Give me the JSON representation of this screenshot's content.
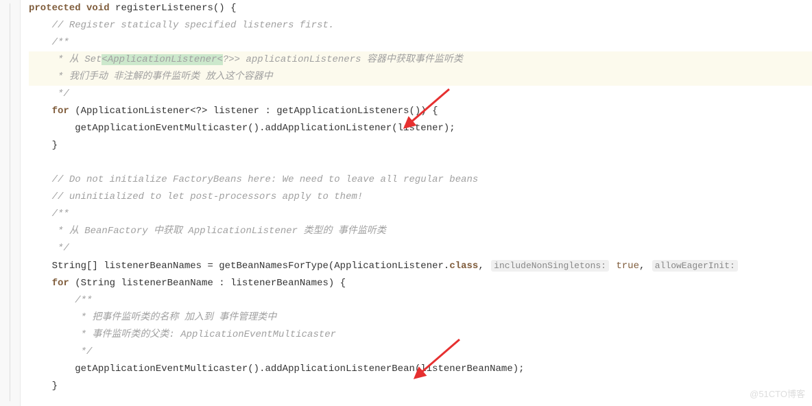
{
  "code": {
    "l1_protected": "protected",
    "l1_void": "void",
    "l1_name": "registerListeners",
    "l1_rest": "() {",
    "l2": "// Register statically specified listeners first.",
    "l3": "/**",
    "l4_pre": " * 从 Set",
    "l4_hl": "<ApplicationListener<",
    "l4_post": "?>> applicationListeners 容器中获取事件监听类",
    "l5": " * 我们手动 非注解的事件监听类 放入这个容器中",
    "l6": " */",
    "l7_for": "for",
    "l7_rest": " (ApplicationListener<?> listener : getApplicationListeners()) {",
    "l8": "getApplicationEventMulticaster().addApplicationListener(listener);",
    "l9": "}",
    "l11": "// Do not initialize FactoryBeans here: We need to leave all regular beans",
    "l12": "// uninitialized to let post-processors apply to them!",
    "l13": "/**",
    "l14": " * 从 BeanFactory 中获取 ApplicationListener 类型的 事件监听类",
    "l15": " */",
    "l16_a": "String[] listenerBeanNames = getBeanNamesForType(ApplicationListener.",
    "l16_class": "class",
    "l16_b": ", ",
    "l16_hint1": "includeNonSingletons:",
    "l16_true": " true",
    "l16_c": ", ",
    "l16_hint2": "allowEagerInit:",
    "l17_for": "for",
    "l17_rest": " (String listenerBeanName : listenerBeanNames) {",
    "l18": "/**",
    "l19": " * 把事件监听类的名称 加入到 事件管理类中",
    "l20": " * 事件监听类的父类: ApplicationEventMulticaster",
    "l21": " */",
    "l22": "getApplicationEventMulticaster().addApplicationListenerBean(listenerBeanName);",
    "l23": "}"
  },
  "watermark": "@51CTO博客"
}
